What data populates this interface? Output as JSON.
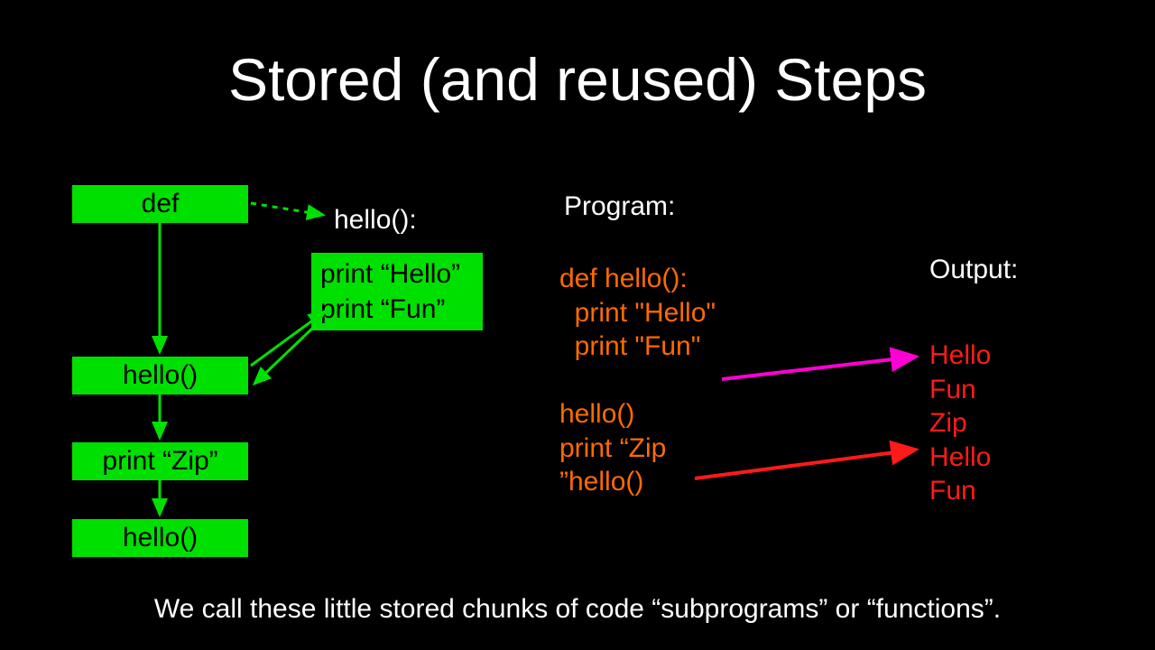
{
  "title": "Stored (and reused) Steps",
  "boxes": {
    "def": "def",
    "hello1": "hello()",
    "printzip": "print “Zip”",
    "hello2": "hello()",
    "body": "print “Hello”\n  print “Fun”"
  },
  "helloLabel": "hello():",
  "program": {
    "heading": "Program:",
    "code": "def hello():\n  print \"Hello\"\n  print \"Fun\"\n\nhello()\nprint “Zip\n”hello()"
  },
  "output": {
    "heading": "Output:",
    "lines": "Hello\nFun\nZip\nHello\nFun"
  },
  "footer": "We call these little stored chunks of code “subprograms” or “functions”."
}
